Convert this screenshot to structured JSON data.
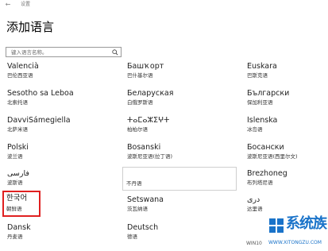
{
  "app": {
    "title": "设置",
    "back_glyph": "←"
  },
  "header": {
    "title": "添加语言"
  },
  "search": {
    "placeholder": "键入语言名称。"
  },
  "languages": [
    {
      "name": "Valencià",
      "sub": "巴伦西亚语"
    },
    {
      "name": "Башҡорт",
      "sub": "巴什基尔语"
    },
    {
      "name": "Euskara",
      "sub": "巴斯克语"
    },
    {
      "name": "Sesotho sa Leboa",
      "sub": "北索托语"
    },
    {
      "name": "Беларуская",
      "sub": "白俄罗斯语"
    },
    {
      "name": "Български",
      "sub": "保加利亚语"
    },
    {
      "name": "DavviSámegiella",
      "sub": "北萨米语"
    },
    {
      "name": "ⵜⴰⵎⴰⵣⵉⵖⵜ",
      "sub": "柏柏尔语"
    },
    {
      "name": "Íslenska",
      "sub": "冰岛语"
    },
    {
      "name": "Polski",
      "sub": "波兰语"
    },
    {
      "name": "Bosanski",
      "sub": "波斯尼亚语(拉丁语)"
    },
    {
      "name": "Босански",
      "sub": "波斯尼亚语(西里尔文)"
    },
    {
      "name": "فارسی",
      "sub": "波斯语"
    },
    {
      "name": "",
      "sub": "不丹语"
    },
    {
      "name": "Brezhoneg",
      "sub": "布列塔尼语"
    },
    {
      "name": "한국어",
      "sub": "朝鲜语"
    },
    {
      "name": "Setswana",
      "sub": "茨瓦纳语"
    },
    {
      "name": "دری",
      "sub": "达里语"
    },
    {
      "name": "Dansk",
      "sub": "丹麦语"
    },
    {
      "name": "Deutsch",
      "sub": "德语"
    },
    {
      "name": "",
      "sub": ""
    }
  ],
  "watermark": {
    "text": "系统族",
    "url": "WWW.XITONGZU.COM",
    "prefix": "WIN10",
    "color": "#1a73c9"
  },
  "colors": {
    "highlight": "#e02020",
    "tile_border": "#cfcfcf"
  }
}
